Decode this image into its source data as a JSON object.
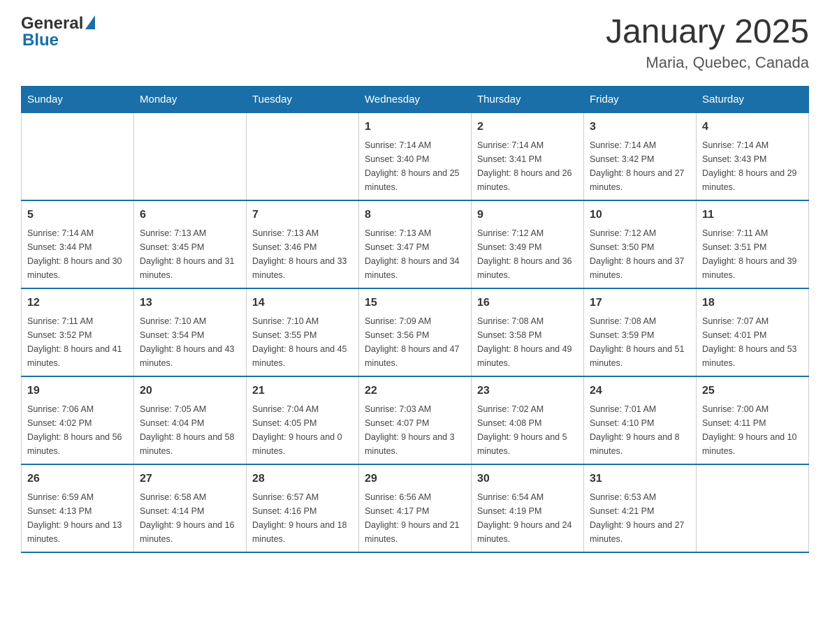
{
  "header": {
    "logo": {
      "general": "General",
      "blue": "Blue"
    },
    "title": "January 2025",
    "subtitle": "Maria, Quebec, Canada"
  },
  "days_of_week": [
    "Sunday",
    "Monday",
    "Tuesday",
    "Wednesday",
    "Thursday",
    "Friday",
    "Saturday"
  ],
  "weeks": [
    [
      {
        "day": "",
        "sunrise": "",
        "sunset": "",
        "daylight": ""
      },
      {
        "day": "",
        "sunrise": "",
        "sunset": "",
        "daylight": ""
      },
      {
        "day": "",
        "sunrise": "",
        "sunset": "",
        "daylight": ""
      },
      {
        "day": "1",
        "sunrise": "Sunrise: 7:14 AM",
        "sunset": "Sunset: 3:40 PM",
        "daylight": "Daylight: 8 hours and 25 minutes."
      },
      {
        "day": "2",
        "sunrise": "Sunrise: 7:14 AM",
        "sunset": "Sunset: 3:41 PM",
        "daylight": "Daylight: 8 hours and 26 minutes."
      },
      {
        "day": "3",
        "sunrise": "Sunrise: 7:14 AM",
        "sunset": "Sunset: 3:42 PM",
        "daylight": "Daylight: 8 hours and 27 minutes."
      },
      {
        "day": "4",
        "sunrise": "Sunrise: 7:14 AM",
        "sunset": "Sunset: 3:43 PM",
        "daylight": "Daylight: 8 hours and 29 minutes."
      }
    ],
    [
      {
        "day": "5",
        "sunrise": "Sunrise: 7:14 AM",
        "sunset": "Sunset: 3:44 PM",
        "daylight": "Daylight: 8 hours and 30 minutes."
      },
      {
        "day": "6",
        "sunrise": "Sunrise: 7:13 AM",
        "sunset": "Sunset: 3:45 PM",
        "daylight": "Daylight: 8 hours and 31 minutes."
      },
      {
        "day": "7",
        "sunrise": "Sunrise: 7:13 AM",
        "sunset": "Sunset: 3:46 PM",
        "daylight": "Daylight: 8 hours and 33 minutes."
      },
      {
        "day": "8",
        "sunrise": "Sunrise: 7:13 AM",
        "sunset": "Sunset: 3:47 PM",
        "daylight": "Daylight: 8 hours and 34 minutes."
      },
      {
        "day": "9",
        "sunrise": "Sunrise: 7:12 AM",
        "sunset": "Sunset: 3:49 PM",
        "daylight": "Daylight: 8 hours and 36 minutes."
      },
      {
        "day": "10",
        "sunrise": "Sunrise: 7:12 AM",
        "sunset": "Sunset: 3:50 PM",
        "daylight": "Daylight: 8 hours and 37 minutes."
      },
      {
        "day": "11",
        "sunrise": "Sunrise: 7:11 AM",
        "sunset": "Sunset: 3:51 PM",
        "daylight": "Daylight: 8 hours and 39 minutes."
      }
    ],
    [
      {
        "day": "12",
        "sunrise": "Sunrise: 7:11 AM",
        "sunset": "Sunset: 3:52 PM",
        "daylight": "Daylight: 8 hours and 41 minutes."
      },
      {
        "day": "13",
        "sunrise": "Sunrise: 7:10 AM",
        "sunset": "Sunset: 3:54 PM",
        "daylight": "Daylight: 8 hours and 43 minutes."
      },
      {
        "day": "14",
        "sunrise": "Sunrise: 7:10 AM",
        "sunset": "Sunset: 3:55 PM",
        "daylight": "Daylight: 8 hours and 45 minutes."
      },
      {
        "day": "15",
        "sunrise": "Sunrise: 7:09 AM",
        "sunset": "Sunset: 3:56 PM",
        "daylight": "Daylight: 8 hours and 47 minutes."
      },
      {
        "day": "16",
        "sunrise": "Sunrise: 7:08 AM",
        "sunset": "Sunset: 3:58 PM",
        "daylight": "Daylight: 8 hours and 49 minutes."
      },
      {
        "day": "17",
        "sunrise": "Sunrise: 7:08 AM",
        "sunset": "Sunset: 3:59 PM",
        "daylight": "Daylight: 8 hours and 51 minutes."
      },
      {
        "day": "18",
        "sunrise": "Sunrise: 7:07 AM",
        "sunset": "Sunset: 4:01 PM",
        "daylight": "Daylight: 8 hours and 53 minutes."
      }
    ],
    [
      {
        "day": "19",
        "sunrise": "Sunrise: 7:06 AM",
        "sunset": "Sunset: 4:02 PM",
        "daylight": "Daylight: 8 hours and 56 minutes."
      },
      {
        "day": "20",
        "sunrise": "Sunrise: 7:05 AM",
        "sunset": "Sunset: 4:04 PM",
        "daylight": "Daylight: 8 hours and 58 minutes."
      },
      {
        "day": "21",
        "sunrise": "Sunrise: 7:04 AM",
        "sunset": "Sunset: 4:05 PM",
        "daylight": "Daylight: 9 hours and 0 minutes."
      },
      {
        "day": "22",
        "sunrise": "Sunrise: 7:03 AM",
        "sunset": "Sunset: 4:07 PM",
        "daylight": "Daylight: 9 hours and 3 minutes."
      },
      {
        "day": "23",
        "sunrise": "Sunrise: 7:02 AM",
        "sunset": "Sunset: 4:08 PM",
        "daylight": "Daylight: 9 hours and 5 minutes."
      },
      {
        "day": "24",
        "sunrise": "Sunrise: 7:01 AM",
        "sunset": "Sunset: 4:10 PM",
        "daylight": "Daylight: 9 hours and 8 minutes."
      },
      {
        "day": "25",
        "sunrise": "Sunrise: 7:00 AM",
        "sunset": "Sunset: 4:11 PM",
        "daylight": "Daylight: 9 hours and 10 minutes."
      }
    ],
    [
      {
        "day": "26",
        "sunrise": "Sunrise: 6:59 AM",
        "sunset": "Sunset: 4:13 PM",
        "daylight": "Daylight: 9 hours and 13 minutes."
      },
      {
        "day": "27",
        "sunrise": "Sunrise: 6:58 AM",
        "sunset": "Sunset: 4:14 PM",
        "daylight": "Daylight: 9 hours and 16 minutes."
      },
      {
        "day": "28",
        "sunrise": "Sunrise: 6:57 AM",
        "sunset": "Sunset: 4:16 PM",
        "daylight": "Daylight: 9 hours and 18 minutes."
      },
      {
        "day": "29",
        "sunrise": "Sunrise: 6:56 AM",
        "sunset": "Sunset: 4:17 PM",
        "daylight": "Daylight: 9 hours and 21 minutes."
      },
      {
        "day": "30",
        "sunrise": "Sunrise: 6:54 AM",
        "sunset": "Sunset: 4:19 PM",
        "daylight": "Daylight: 9 hours and 24 minutes."
      },
      {
        "day": "31",
        "sunrise": "Sunrise: 6:53 AM",
        "sunset": "Sunset: 4:21 PM",
        "daylight": "Daylight: 9 hours and 27 minutes."
      },
      {
        "day": "",
        "sunrise": "",
        "sunset": "",
        "daylight": ""
      }
    ]
  ]
}
